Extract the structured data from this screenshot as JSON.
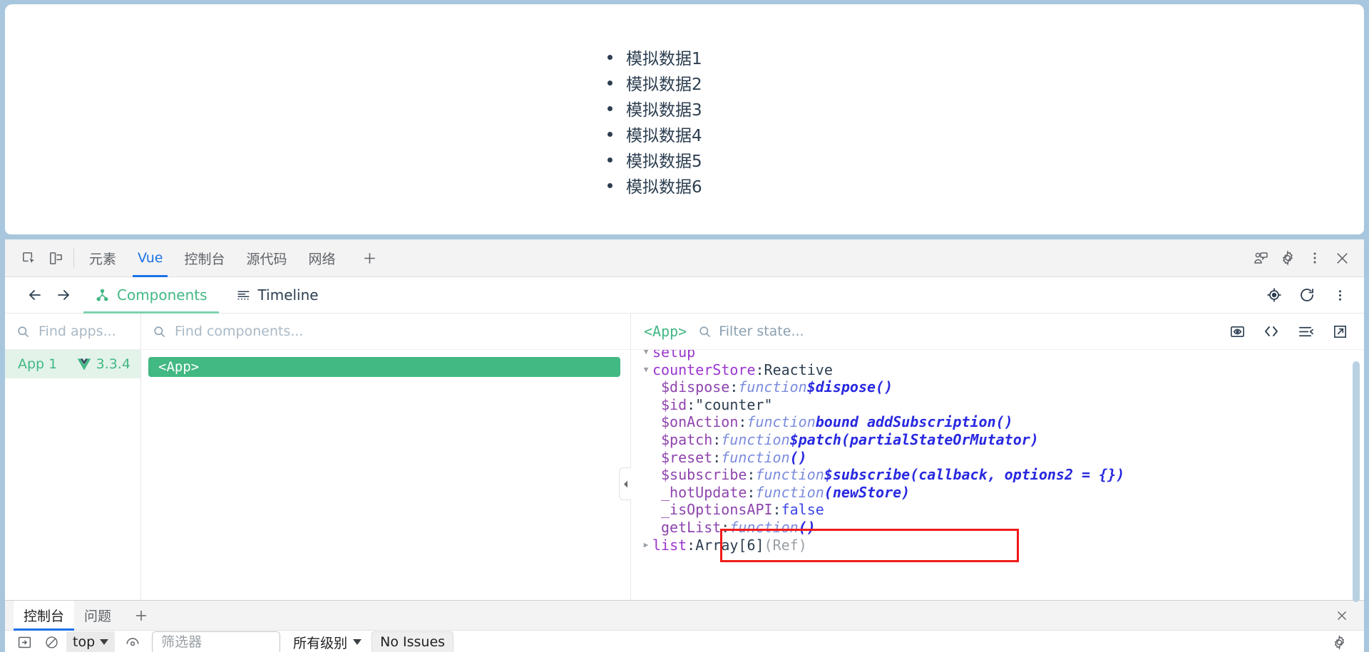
{
  "page": {
    "list_items": [
      "模拟数据1",
      "模拟数据2",
      "模拟数据3",
      "模拟数据4",
      "模拟数据5",
      "模拟数据6"
    ]
  },
  "devtools": {
    "tabs": [
      {
        "label": "元素",
        "active": false
      },
      {
        "label": "Vue",
        "active": true
      },
      {
        "label": "控制台",
        "active": false
      },
      {
        "label": "源代码",
        "active": false
      },
      {
        "label": "网络",
        "active": false
      }
    ],
    "add_tab_label": "+",
    "icons": {
      "inspect": "inspect-element-icon",
      "device": "device-toolbar-icon",
      "review": "review-changes-icon",
      "settings": "gear-icon",
      "more": "more-vertical-icon",
      "close": "close-icon"
    }
  },
  "vue_panel": {
    "back_label": "←",
    "forward_label": "→",
    "tabs": [
      {
        "label": "Components",
        "active": true
      },
      {
        "label": "Timeline",
        "active": false
      }
    ],
    "toolbar_icons": [
      "target-icon",
      "refresh-icon",
      "more-vertical-icon"
    ]
  },
  "apps": {
    "search_placeholder": "Find apps...",
    "search_value": "",
    "items": [
      {
        "name": "App 1",
        "version": "3.3.4",
        "selected": true
      }
    ]
  },
  "components": {
    "search_placeholder": "Find components...",
    "search_value": "",
    "tree": [
      {
        "label": "<App>",
        "selected": true
      }
    ],
    "collapse_handle": "◀"
  },
  "state": {
    "component_name": "<App>",
    "filter_placeholder": "Filter state...",
    "filter_value": "",
    "toolbar_icons": [
      "inspect-dom-icon",
      "open-in-editor-icon",
      "collapse-all-icon",
      "detach-window-icon"
    ],
    "rows": [
      {
        "indent": 0,
        "arrow": "▼",
        "key": "setup",
        "sep": "",
        "value": "",
        "value_type": "plain",
        "cut_top": true
      },
      {
        "indent": 0,
        "arrow": "▼",
        "key": "counterStore",
        "sep": ": ",
        "value": "Reactive",
        "value_type": "plain"
      },
      {
        "indent": 1,
        "arrow": "",
        "key": "$dispose",
        "sep": ": ",
        "value": "function ",
        "value2": "$dispose()",
        "value_type": "function"
      },
      {
        "indent": 1,
        "arrow": "",
        "key": "$id",
        "sep": ": ",
        "value": "\"counter\"",
        "value_type": "string"
      },
      {
        "indent": 1,
        "arrow": "",
        "key": "$onAction",
        "sep": ": ",
        "value": "function ",
        "value2": "bound addSubscription()",
        "value_type": "function"
      },
      {
        "indent": 1,
        "arrow": "",
        "key": "$patch",
        "sep": ": ",
        "value": "function ",
        "value2": "$patch(partialStateOrMutator)",
        "value_type": "function"
      },
      {
        "indent": 1,
        "arrow": "",
        "key": "$reset",
        "sep": ": ",
        "value": "function ",
        "value2": "()",
        "value_type": "function"
      },
      {
        "indent": 1,
        "arrow": "",
        "key": "$subscribe",
        "sep": ": ",
        "value": "function ",
        "value2": "$subscribe(callback, options2 = {})",
        "value_type": "function"
      },
      {
        "indent": 1,
        "arrow": "",
        "key": "_hotUpdate",
        "sep": ": ",
        "value": "function ",
        "value2": "(newStore)",
        "value_type": "function"
      },
      {
        "indent": 1,
        "arrow": "",
        "key": "_isOptionsAPI",
        "sep": ": ",
        "value": "false",
        "value_type": "boolean"
      },
      {
        "indent": 1,
        "arrow": "",
        "key": "getList",
        "sep": ": ",
        "value": "function ",
        "value2": "()",
        "value_type": "function"
      },
      {
        "indent": 0,
        "arrow": "▶",
        "key": "list",
        "sep": ": ",
        "value": "Array[6] ",
        "value2": "(Ref)",
        "value_type": "array",
        "highlighted": true
      }
    ]
  },
  "drawer": {
    "tabs": [
      {
        "label": "控制台",
        "active": true
      },
      {
        "label": "问题",
        "active": false
      }
    ],
    "add_tab_label": "+",
    "close_label": "×",
    "context_value": "top",
    "filter_placeholder": "筛选器",
    "filter_value": "",
    "level_value": "所有级别",
    "issues_label": "No Issues",
    "icons": [
      "console-sidebar-icon",
      "clear-console-icon",
      "live-expression-icon",
      "settings-gear-icon"
    ]
  },
  "colors": {
    "vue_green": "#42b883",
    "chrome_blue": "#1a73e8",
    "highlight_red": "#f01b1b",
    "key_purple": "#9b35cf",
    "fn_blue": "#2828e0",
    "window_chrome": "#a8c6dd"
  }
}
